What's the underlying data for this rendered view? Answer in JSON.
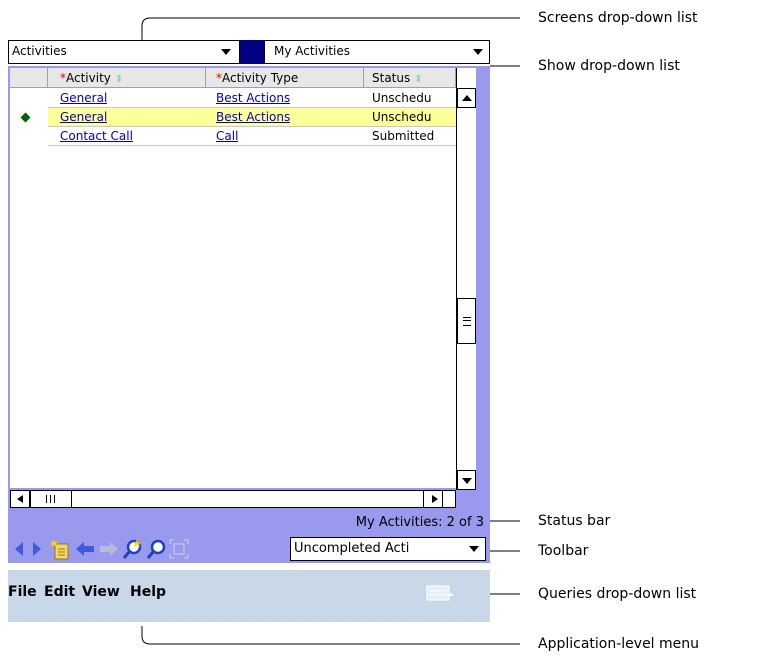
{
  "screens_dropdown": {
    "value": "Activities"
  },
  "show_dropdown": {
    "value": "My Activities"
  },
  "grid": {
    "columns": [
      {
        "required": "*",
        "label": "Activity",
        "sort": "⬍"
      },
      {
        "required": "*",
        "label": "Activity Type",
        "sort": ""
      },
      {
        "required": "",
        "label": "Status",
        "sort": "⬍"
      }
    ],
    "rows": [
      {
        "activity": "General",
        "type": "Best Actions",
        "status": "Unschedu",
        "selected": false
      },
      {
        "activity": "General",
        "type": "Best Actions",
        "status": "Unschedu",
        "selected": true
      },
      {
        "activity": "Contact Call",
        "type": "Call",
        "status": "Submitted",
        "selected": false
      }
    ]
  },
  "status_bar": {
    "text": "My Activities:  2 of 3"
  },
  "toolbar": {
    "icons": [
      "back-arrow-icon",
      "forward-arrow-icon",
      "new-record-icon",
      "previous-record-icon",
      "next-record-icon",
      "query-icon",
      "find-icon",
      "maximize-icon"
    ],
    "queries_value": "Uncompleted Acti"
  },
  "menu": {
    "items": [
      "File",
      "Edit",
      "View",
      "Help"
    ]
  },
  "callouts": {
    "screens": "Screens drop-down list",
    "show": "Show drop-down list",
    "status": "Status bar",
    "toolbar": "Toolbar",
    "queries": "Queries drop-down list",
    "appmenu": "Application-level menu"
  },
  "colors": {
    "panel": "#9999ee",
    "selected_row": "#ffff99",
    "link": "#0000cc",
    "menubar": "#c8d8e8",
    "separator": "#000080"
  }
}
